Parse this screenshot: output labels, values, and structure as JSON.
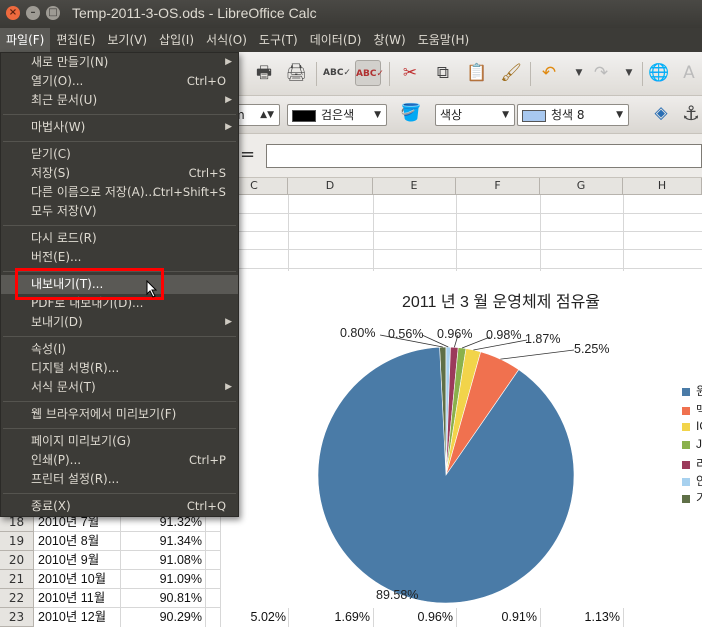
{
  "window": {
    "title": "Temp-2011-3-OS.ods - LibreOffice Calc"
  },
  "menubar": [
    {
      "label": "파일(F)",
      "active": true
    },
    {
      "label": "편집(E)"
    },
    {
      "label": "보기(V)"
    },
    {
      "label": "삽입(I)"
    },
    {
      "label": "서식(O)"
    },
    {
      "label": "도구(T)"
    },
    {
      "label": "데이터(D)"
    },
    {
      "label": "창(W)"
    },
    {
      "label": "도움말(H)"
    }
  ],
  "toolbar2": {
    "font_size": "m",
    "font_color": "검은색",
    "area_style": "색상",
    "area_color": "청색 8"
  },
  "columns": [
    "C",
    "D",
    "E",
    "F",
    "G",
    "H"
  ],
  "rows": [
    {
      "num": "18",
      "label": "2010년 7월",
      "value": "91.32%"
    },
    {
      "num": "19",
      "label": "2010년 8월",
      "value": "91.34%"
    },
    {
      "num": "20",
      "label": "2010년 9월",
      "value": "91.08%"
    },
    {
      "num": "21",
      "label": "2010년 10월",
      "value": "91.09%"
    },
    {
      "num": "22",
      "label": "2010년 11월",
      "value": "90.81%"
    },
    {
      "num": "23",
      "label": "2010년 12월",
      "value": "90.29%",
      "extra": [
        "5.02%",
        "1.69%",
        "0.96%",
        "0.91%",
        "1.13%"
      ]
    }
  ],
  "file_menu": {
    "items": [
      {
        "label": "새로 만들기(N)",
        "submenu": true
      },
      {
        "label": "열기(O)...",
        "shortcut": "Ctrl+O"
      },
      {
        "label": "최근 문서(U)",
        "submenu": true
      },
      {
        "label": "마법사(W)",
        "submenu": true
      },
      {
        "label": "닫기(C)"
      },
      {
        "label": "저장(S)",
        "shortcut": "Ctrl+S"
      },
      {
        "label": "다른 이름으로 저장(A)...",
        "shortcut": "Ctrl+Shift+S"
      },
      {
        "label": "모두 저장(V)"
      },
      {
        "label": "다시 로드(R)"
      },
      {
        "label": "버전(E)..."
      },
      {
        "label": "내보내기(T)...",
        "highlighted": true
      },
      {
        "label": "PDF로 내보내기(D)..."
      },
      {
        "label": "보내기(D)",
        "submenu": true
      },
      {
        "label": "속성(I)"
      },
      {
        "label": "디지털 서명(R)..."
      },
      {
        "label": "서식 문서(T)",
        "submenu": true
      },
      {
        "label": "웹 브라우저에서 미리보기(F)"
      },
      {
        "label": "페이지 미리보기(G)"
      },
      {
        "label": "인쇄(P)...",
        "shortcut": "Ctrl+P"
      },
      {
        "label": "프린터 설정(R)..."
      },
      {
        "label": "종료(X)",
        "shortcut": "Ctrl+Q"
      }
    ]
  },
  "chart_data": {
    "type": "pie",
    "title": "2011 년 3 월 운영체제 점유율",
    "values": [
      89.58,
      5.25,
      1.87,
      0.98,
      0.96,
      0.56,
      0.8
    ],
    "labels": [
      "89.58%",
      "5.25%",
      "1.87%",
      "0.98%",
      "0.96%",
      "0.56%",
      "0.80%"
    ],
    "colors": [
      "#4a7ba7",
      "#f0714f",
      "#f2d44a",
      "#8ab14b",
      "#9b3a5b",
      "#a7d1ef",
      "#5f6f47"
    ],
    "legend": [
      "윈",
      "맥",
      "IO",
      "Ja",
      "리",
      "안",
      "기"
    ],
    "legend_position": "right"
  }
}
